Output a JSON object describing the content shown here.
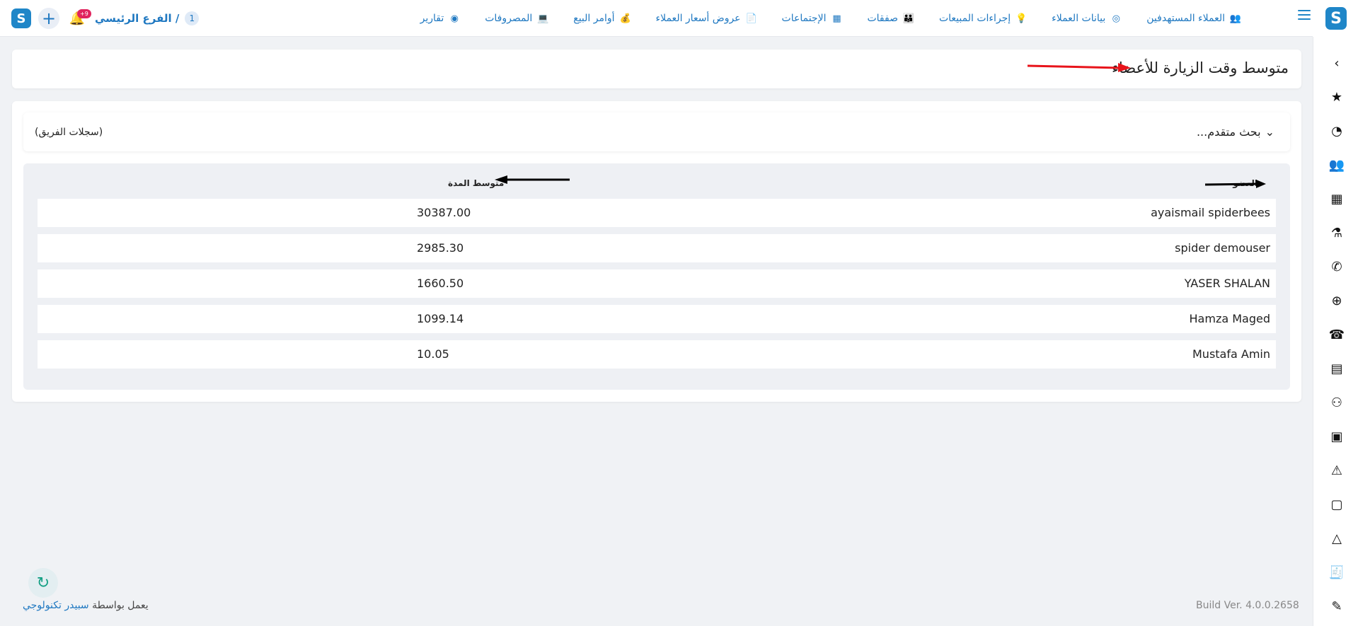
{
  "topbar": {
    "branch_label": "الفرع الرئيسي /",
    "branch_number": "1",
    "notification_count": "+9",
    "nav": [
      {
        "label": "العملاء المستهدفين",
        "icon": "target-customers-icon",
        "color": "#2c6ea8"
      },
      {
        "label": "بيانات العملاء",
        "icon": "customer-data-icon",
        "color": "#2c6ea8"
      },
      {
        "label": "إجراءات المبيعات",
        "icon": "sales-actions-icon",
        "color": "#e0a800"
      },
      {
        "label": "صفقات",
        "icon": "deals-icon",
        "color": "#2c6ea8"
      },
      {
        "label": "الإجتماعات",
        "icon": "meetings-icon",
        "color": "#2c6ea8"
      },
      {
        "label": "عروض أسعار العملاء",
        "icon": "quotes-icon",
        "color": "#e0a800"
      },
      {
        "label": "أوامر البيع",
        "icon": "sales-orders-icon",
        "color": "#2c9d6a"
      },
      {
        "label": "المصروفات",
        "icon": "expenses-icon",
        "color": "#2c6ea8"
      },
      {
        "label": "تقارير",
        "icon": "reports-icon",
        "color": "#e0a800"
      }
    ]
  },
  "page": {
    "title": "متوسط وقت الزيارة للأعضاء",
    "advanced_search": "بحث متقدم...",
    "team_records": "(سجلات الفريق)"
  },
  "table": {
    "headers": {
      "member": "العضو",
      "avg": "متوسط المدة"
    },
    "rows": [
      {
        "name": "ayaismail spiderbees",
        "avg": "30387.00"
      },
      {
        "name": "spider demouser",
        "avg": "2985.30"
      },
      {
        "name": "YASER SHALAN",
        "avg": "1660.50"
      },
      {
        "name": "Hamza Maged",
        "avg": "1099.14"
      },
      {
        "name": "Mustafa Amin",
        "avg": "10.05"
      }
    ]
  },
  "footer": {
    "powered_by": "يعمل بواسطة",
    "company": "سبيدر تكنولوجي",
    "build": "Build Ver. 4.0.0.2658"
  },
  "colors": {
    "accent": "#1f78c1",
    "arrow_red": "#e8141b",
    "arrow_black": "#000000"
  }
}
